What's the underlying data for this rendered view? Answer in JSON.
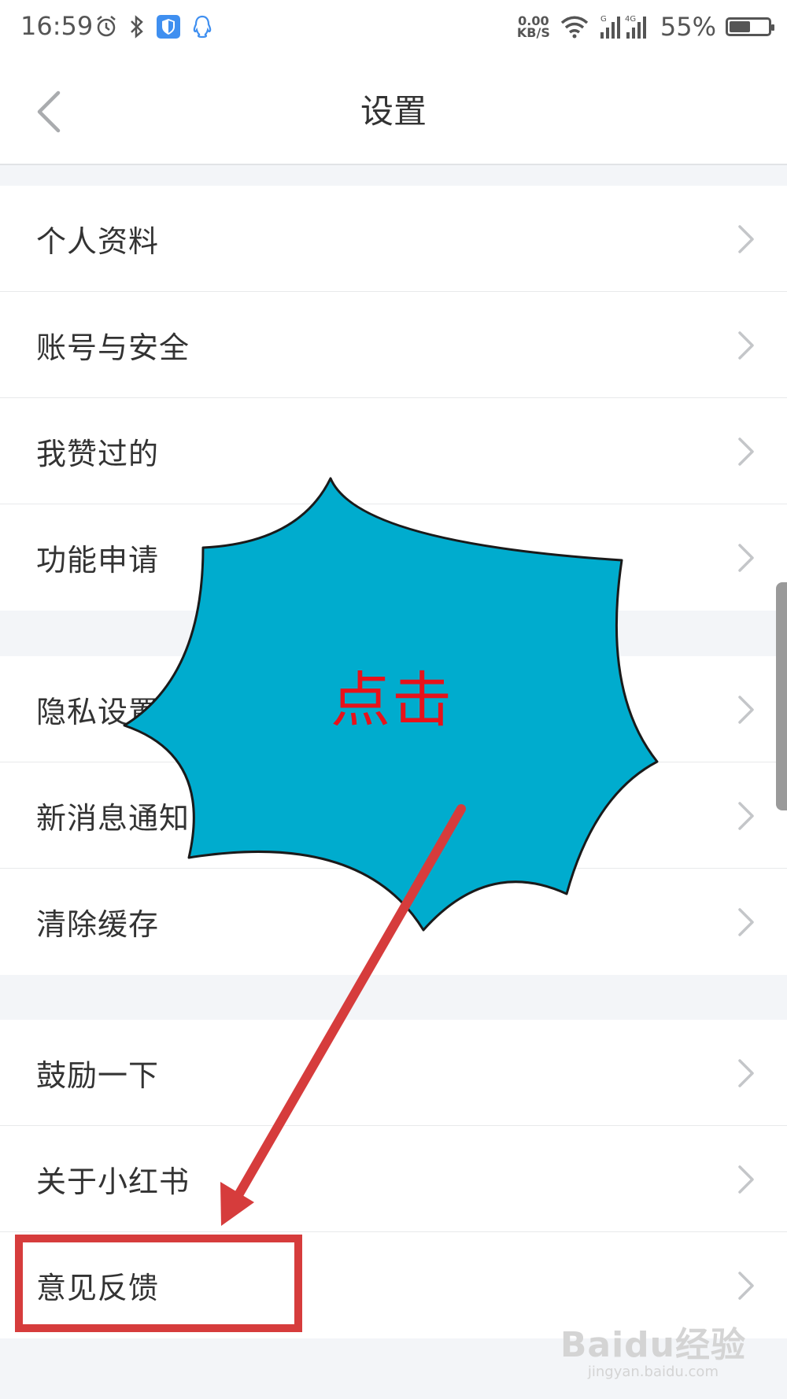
{
  "status_bar": {
    "time": "16:59",
    "net_speed_value": "0.00",
    "net_speed_unit": "KB/S",
    "network_1": "G",
    "network_2": "4G",
    "battery_percent": "55%",
    "battery_level": 0.55,
    "left_icons": [
      "alarm-icon",
      "bluetooth-icon",
      "shield-icon",
      "qq-icon"
    ],
    "right_icons": [
      "wifi-icon",
      "signal-icon",
      "battery-icon"
    ]
  },
  "nav": {
    "title": "设置",
    "back_icon": "chevron-left-icon"
  },
  "groups": [
    {
      "items": [
        {
          "label": "个人资料"
        },
        {
          "label": "账号与安全"
        },
        {
          "label": "我赞过的"
        },
        {
          "label": "功能申请"
        }
      ]
    },
    {
      "items": [
        {
          "label": "隐私设置"
        },
        {
          "label": "新消息通知"
        },
        {
          "label": "清除缓存"
        }
      ]
    },
    {
      "items": [
        {
          "label": "鼓励一下"
        },
        {
          "label": "关于小红书"
        },
        {
          "label": "意见反馈"
        }
      ]
    }
  ],
  "annotation": {
    "callout_text": "点击",
    "callout_color": "#00acce",
    "arrow_color": "#d63c3c",
    "highlight_color": "#d63c3c"
  },
  "watermark": {
    "logo": "Baidu经验",
    "url": "jingyan.baidu.com"
  }
}
